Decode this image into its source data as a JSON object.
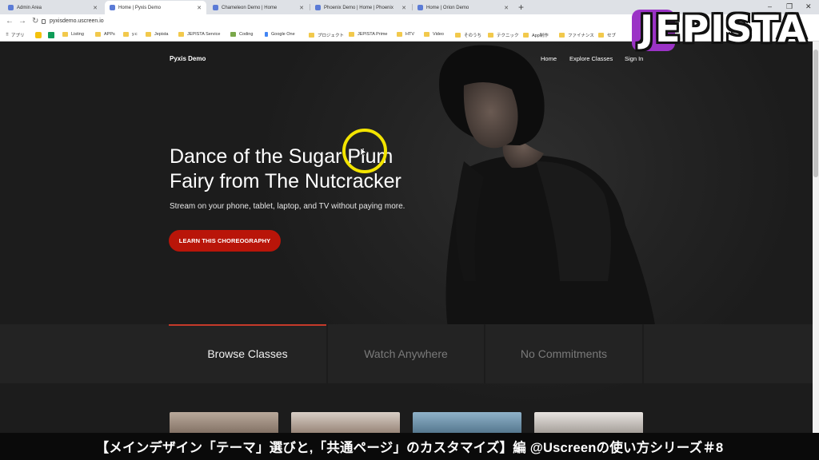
{
  "browser": {
    "tabs": [
      {
        "title": "Admin Area"
      },
      {
        "title": "Home | Pyxis Demo"
      },
      {
        "title": "Chameleon Demo | Home"
      },
      {
        "title": "Phoenix Demo | Home | Phoenix"
      },
      {
        "title": "Home | Orion Demo"
      }
    ],
    "active_tab": 1,
    "url": "pyxisdemo.uscreen.io",
    "bookmarks": [
      "アプリ",
      "Listing",
      "APPs",
      "y.c",
      "Jepista",
      "JEPISTA Service",
      "Coding",
      "Google One",
      "プロジェクト",
      "JEPISTA Prime",
      "HTV",
      "Video",
      "そのうち",
      "テクニック",
      "App制作",
      "ファイナンス",
      "セブ"
    ]
  },
  "site": {
    "logo": "Pyxis Demo",
    "nav": [
      "Home",
      "Explore Classes",
      "Sign In"
    ],
    "hero_title": "Dance of the Sugar Plum Fairy from The Nutcracker",
    "hero_subtitle": "Stream on your phone, tablet, laptop, and TV without paying more.",
    "cta": "LEARN THIS CHOREOGRAPHY",
    "features": [
      "Browse Classes",
      "Watch Anywhere",
      "No Commitments"
    ],
    "active_feature": 0
  },
  "caption": "【メインデザイン「テーマ」選びと,「共通ページ」のカスタマイズ】編 @Uscreenの使い方シリーズ＃8",
  "channel_logo": "JEPISTA",
  "colors": {
    "cta": "#b91509",
    "accent_bar": "#c53a2a",
    "cursor_ring": "#f3e400",
    "logo_badge": "#9b33c6"
  }
}
